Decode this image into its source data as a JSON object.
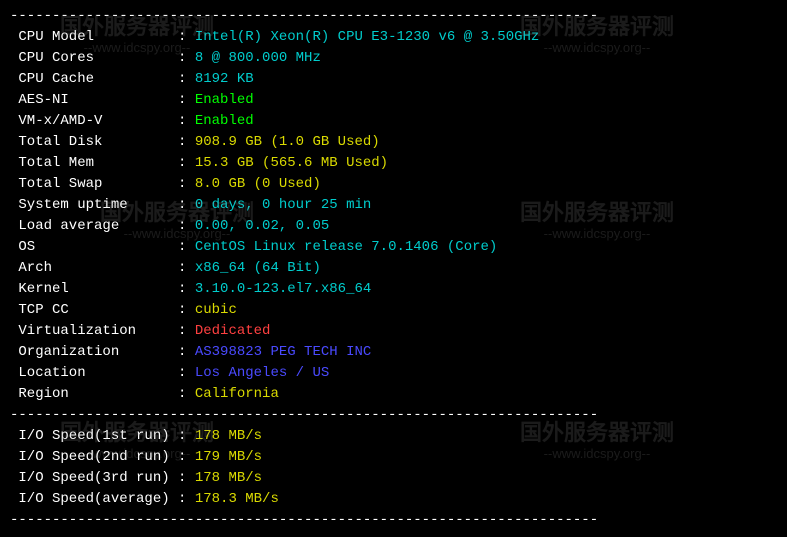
{
  "sys": [
    {
      "label": "CPU Model",
      "value": "Intel(R) Xeon(R) CPU E3-1230 v6 @ 3.50GHz",
      "cls": "val-cyan"
    },
    {
      "label": "CPU Cores",
      "value": "8 @ 800.000 MHz",
      "cls": "val-cyan"
    },
    {
      "label": "CPU Cache",
      "value": "8192 KB",
      "cls": "val-cyan"
    },
    {
      "label": "AES-NI",
      "value": "Enabled",
      "cls": "val-green"
    },
    {
      "label": "VM-x/AMD-V",
      "value": "Enabled",
      "cls": "val-green"
    },
    {
      "label": "Total Disk",
      "value": "908.9 GB (1.0 GB Used)",
      "cls": "val-yellow"
    },
    {
      "label": "Total Mem",
      "value": "15.3 GB (565.6 MB Used)",
      "cls": "val-yellow"
    },
    {
      "label": "Total Swap",
      "value": "8.0 GB (0 Used)",
      "cls": "val-yellow"
    },
    {
      "label": "System uptime",
      "value": "0 days, 0 hour 25 min",
      "cls": "val-cyan"
    },
    {
      "label": "Load average",
      "value": "0.00, 0.02, 0.05",
      "cls": "val-cyan"
    },
    {
      "label": "OS",
      "value": "CentOS Linux release 7.0.1406 (Core)",
      "cls": "val-cyan"
    },
    {
      "label": "Arch",
      "value": "x86_64 (64 Bit)",
      "cls": "val-cyan"
    },
    {
      "label": "Kernel",
      "value": "3.10.0-123.el7.x86_64",
      "cls": "val-cyan"
    },
    {
      "label": "TCP CC",
      "value": "cubic",
      "cls": "val-yellow"
    },
    {
      "label": "Virtualization",
      "value": "Dedicated",
      "cls": "val-red"
    },
    {
      "label": "Organization",
      "value": "AS398823 PEG TECH INC",
      "cls": "val-blue"
    },
    {
      "label": "Location",
      "value": "Los Angeles / US",
      "cls": "val-blue"
    },
    {
      "label": "Region",
      "value": "California",
      "cls": "val-yellow"
    }
  ],
  "io": [
    {
      "label": "I/O Speed(1st run)",
      "value": "178 MB/s",
      "cls": "val-yellow"
    },
    {
      "label": "I/O Speed(2nd run)",
      "value": "179 MB/s",
      "cls": "val-yellow"
    },
    {
      "label": "I/O Speed(3rd run)",
      "value": "178 MB/s",
      "cls": "val-yellow"
    },
    {
      "label": "I/O Speed(average)",
      "value": "178.3 MB/s",
      "cls": "val-yellow"
    }
  ],
  "dashes": "----------------------------------------------------------------------",
  "wm": {
    "big": "国外服务器评测",
    "small": "--www.idcspy.org--"
  }
}
